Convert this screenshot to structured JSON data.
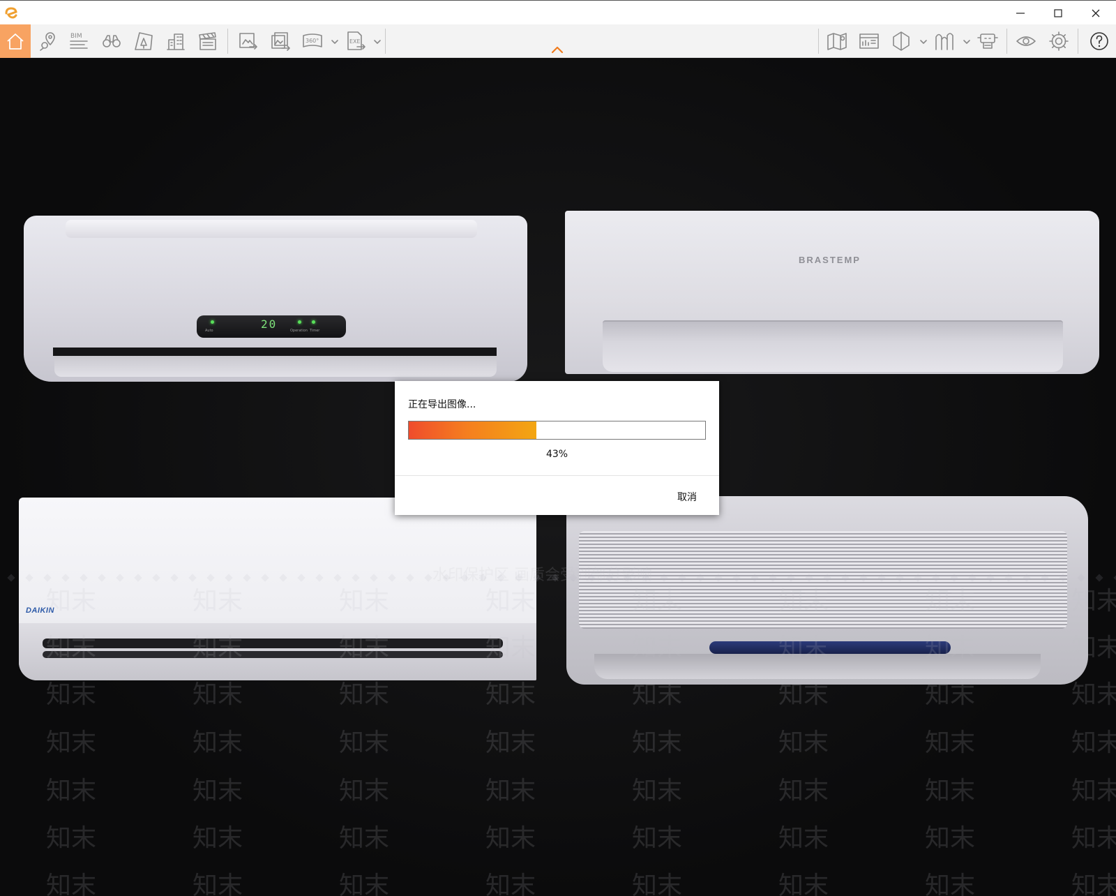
{
  "titlebar": {
    "icons": [
      "app-logo-icon",
      "minimize-icon",
      "maximize-icon",
      "close-icon"
    ]
  },
  "toolbar": {
    "bim_label": "BIM",
    "pano_label": "360°",
    "exe_label": "EXE",
    "left_tools": [
      "home-icon",
      "location-pin-icon",
      "bim-icon",
      "binoculars-icon",
      "landscape-icon",
      "buildings-icon",
      "clapperboard-icon",
      "export-image-icon",
      "batch-export-icon",
      "panorama-360-icon",
      "export-exe-icon"
    ],
    "right_tools": [
      "map-pin-icon",
      "dashboard-icon",
      "section-box-icon",
      "sculpture-icon",
      "robot-icon",
      "eye-icon",
      "gear-icon",
      "help-icon"
    ],
    "accent_color": "#f8a362"
  },
  "scene": {
    "ac1_temp": "20",
    "ac1_label_auto": "Auto",
    "ac1_label_ops": "Operation  Timer",
    "ac2_brand": "BRASTEMP",
    "ac3_brand": "DAIKIN"
  },
  "watermark": {
    "banner": "水印保护区    画质会受到部分影响",
    "mark": "知末"
  },
  "dialog": {
    "title": "正在导出图像...",
    "progress": 0.43,
    "progress_text": "43%",
    "cancel_label": "取消"
  }
}
